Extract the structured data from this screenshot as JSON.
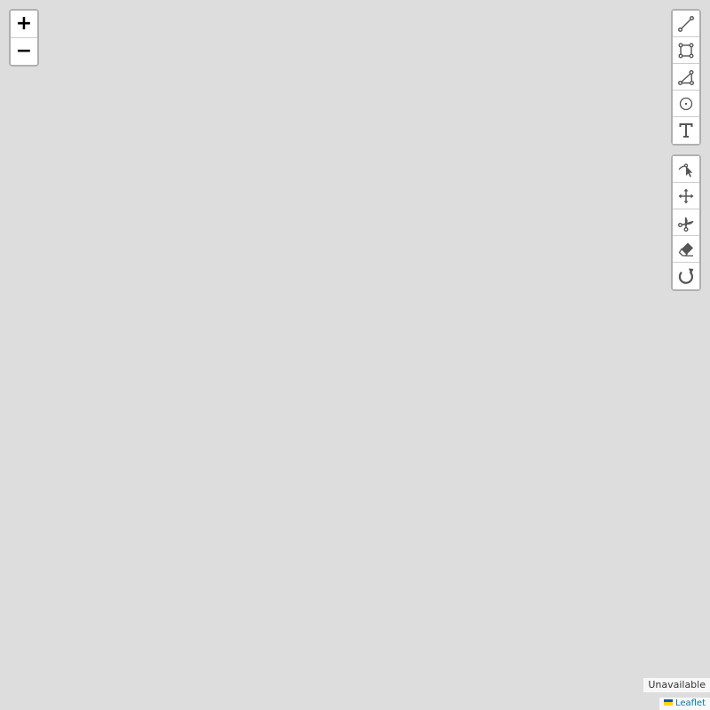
{
  "map": {
    "background_color": "#dddddd"
  },
  "zoom": {
    "zoom_in_label": "+",
    "zoom_out_label": "−"
  },
  "draw_tools": [
    {
      "icon": "polyline-icon"
    },
    {
      "icon": "rectangle-icon"
    },
    {
      "icon": "polygon-icon"
    },
    {
      "icon": "circle-marker-icon"
    },
    {
      "icon": "text-icon"
    }
  ],
  "edit_tools": [
    {
      "icon": "edit-vertices-icon"
    },
    {
      "icon": "move-icon"
    },
    {
      "icon": "cut-icon"
    },
    {
      "icon": "eraser-icon"
    },
    {
      "icon": "rotate-icon"
    }
  ],
  "attribution": {
    "main": "Unavailable",
    "leaflet": "Leaflet",
    "flag_colors": [
      "#0057b7",
      "#ffd700"
    ]
  },
  "colors": {
    "icon": "#555555",
    "link": "#0078a8"
  }
}
